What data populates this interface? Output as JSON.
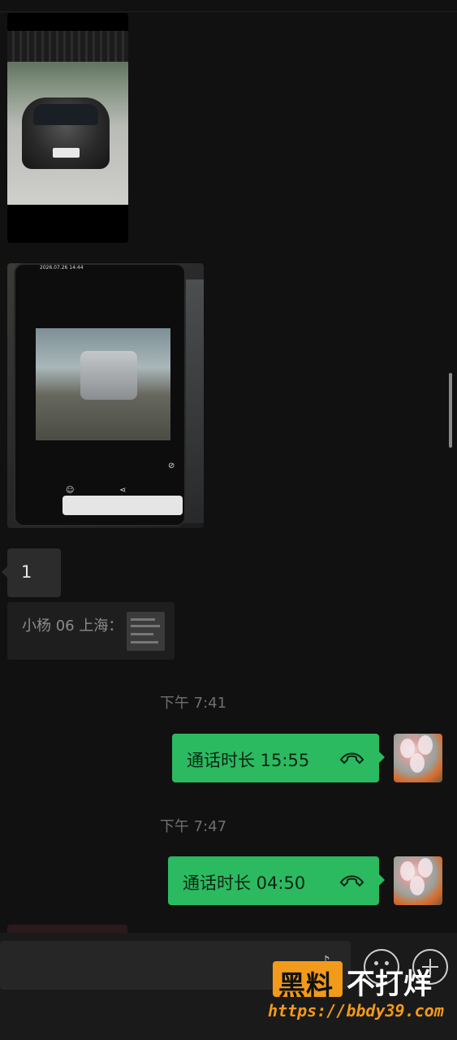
{
  "messages": {
    "text_reply": "1",
    "quote_text": "小杨 06 上海：",
    "photo2_timestamp": "2026.07.26 14:44"
  },
  "times": {
    "t1": "下午 7:41",
    "t2": "下午 7:47"
  },
  "calls": [
    {
      "label": "通话时长 15:55"
    },
    {
      "label": "通话时长 04:50"
    }
  ],
  "watermark": {
    "brand_box": "黑料",
    "brand_text": "不打烊",
    "url": "https://bbdy39.com"
  },
  "colors": {
    "outgoing_bubble": "#2bba60",
    "incoming_bubble": "#2c2c2c",
    "watermark_accent": "#f29a1a"
  },
  "icons": {
    "call": "phone-hangup-icon",
    "emoji": "emoji-icon",
    "plus": "plus-icon",
    "mic": "voice-icon"
  }
}
